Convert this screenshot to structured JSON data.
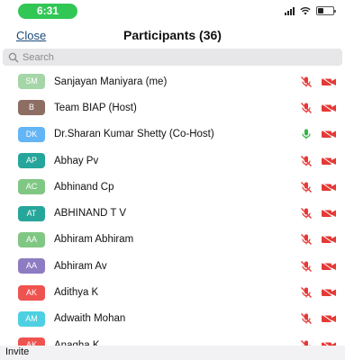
{
  "status_bar": {
    "time": "6:31",
    "time_pill_color": "#31c754"
  },
  "header": {
    "close_label": "Close",
    "title": "Participants (36)"
  },
  "search": {
    "placeholder": "Search"
  },
  "colors": {
    "mic_muted": "#e53935",
    "mic_active": "#34b349",
    "video_off": "#e53935"
  },
  "participants": [
    {
      "initials": "SM",
      "name": "Sanjayan Maniyara (me)",
      "avatar_color": "#a5d6a7",
      "mic": "muted",
      "video": "off"
    },
    {
      "initials": "B",
      "name": "Team BIAP (Host)",
      "avatar_color": "#8d6e63",
      "mic": "muted",
      "video": "off"
    },
    {
      "initials": "DK",
      "name": "Dr.Sharan Kumar Shetty (Co-Host)",
      "avatar_color": "#64b5f6",
      "mic": "active",
      "video": "off"
    },
    {
      "initials": "AP",
      "name": "Abhay Pv",
      "avatar_color": "#26a69a",
      "mic": "muted",
      "video": "off"
    },
    {
      "initials": "AC",
      "name": "Abhinand Cp",
      "avatar_color": "#81c784",
      "mic": "muted",
      "video": "off"
    },
    {
      "initials": "AT",
      "name": "ABHINAND T V",
      "avatar_color": "#26a69a",
      "mic": "muted",
      "video": "off"
    },
    {
      "initials": "AA",
      "name": "Abhiram Abhiram",
      "avatar_color": "#81c784",
      "mic": "muted",
      "video": "off"
    },
    {
      "initials": "AA",
      "name": "Abhiram Av",
      "avatar_color": "#8e7cc3",
      "mic": "muted",
      "video": "off"
    },
    {
      "initials": "AK",
      "name": "Adithya K",
      "avatar_color": "#ef5350",
      "mic": "muted",
      "video": "off"
    },
    {
      "initials": "AM",
      "name": "Adwaith Mohan",
      "avatar_color": "#4dd0e1",
      "mic": "muted",
      "video": "off"
    },
    {
      "initials": "AK",
      "name": "Anagha K",
      "avatar_color": "#ef5350",
      "mic": "muted",
      "video": "off"
    }
  ],
  "footer": {
    "invite_label": "Invite"
  }
}
